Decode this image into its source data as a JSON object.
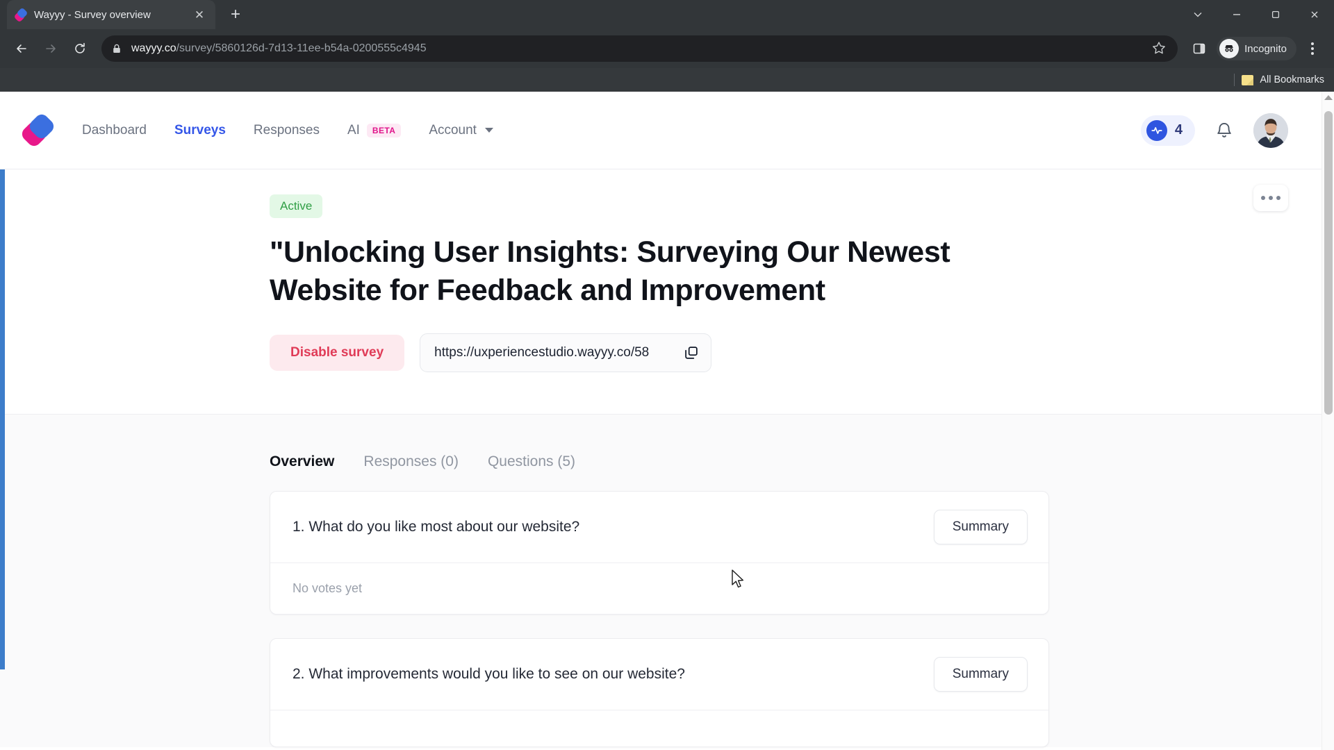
{
  "browser": {
    "tab": {
      "title": "Wayyy - Survey overview",
      "favicon_icon": "wayyy-logo-icon",
      "close_icon": "close-icon"
    },
    "new_tab_icon": "plus-icon",
    "window_controls": {
      "chevron_down_icon": "chevron-down-icon",
      "minimize_icon": "minimize-icon",
      "maximize_icon": "maximize-icon",
      "close_icon": "close-icon"
    },
    "toolbar": {
      "back_icon": "arrow-left-icon",
      "forward_icon": "arrow-right-icon",
      "reload_icon": "reload-icon",
      "lock_icon": "lock-icon",
      "url_strong": "wayyy.co",
      "url_dim": "/survey/5860126d-7d13-11ee-b54a-0200555c4945",
      "star_icon": "star-icon",
      "side_panel_icon": "side-panel-icon",
      "incognito_label": "Incognito",
      "incognito_icon": "incognito-icon",
      "menu_icon": "kebab-menu-icon"
    },
    "bookmarks": {
      "folder_icon": "folder-icon",
      "label": "All Bookmarks"
    }
  },
  "appnav": {
    "logo_icon": "wayyy-logo-icon",
    "links": [
      {
        "label": "Dashboard",
        "active": false
      },
      {
        "label": "Surveys",
        "active": true
      },
      {
        "label": "Responses",
        "active": false
      },
      {
        "label": "AI",
        "badge": "BETA",
        "active": false
      },
      {
        "label": "Account",
        "has_chevron": true,
        "active": false
      }
    ],
    "credits": {
      "value": "4",
      "icon": "activity-pulse-icon"
    },
    "notifications_icon": "bell-icon",
    "avatar_icon": "user-avatar"
  },
  "hero": {
    "more_menu_icon": "ellipsis-icon",
    "status": "Active",
    "title": "\"Unlocking User Insights: Surveying Our Newest Website for Feedback and Improvement",
    "disable_button": "Disable survey",
    "share_url": "https://uxperiencestudio.wayyy.co/58",
    "copy_icon": "copy-icon"
  },
  "main": {
    "tabs": [
      {
        "label": "Overview",
        "active": true
      },
      {
        "label": "Responses (0)",
        "active": false
      },
      {
        "label": "Questions (5)",
        "active": false
      }
    ],
    "questions": [
      {
        "title": "1. What do you like most about our website?",
        "summary_button": "Summary",
        "body": "No votes yet"
      },
      {
        "title": "2. What improvements would you like to see on our website?",
        "summary_button": "Summary",
        "body": ""
      }
    ]
  },
  "colors": {
    "accent_blue": "#3456e8",
    "left_bar_blue": "#3d7dca",
    "status_green": "#2f9e44",
    "danger_red": "#e03b57",
    "beta_pink": "#e0148a"
  }
}
